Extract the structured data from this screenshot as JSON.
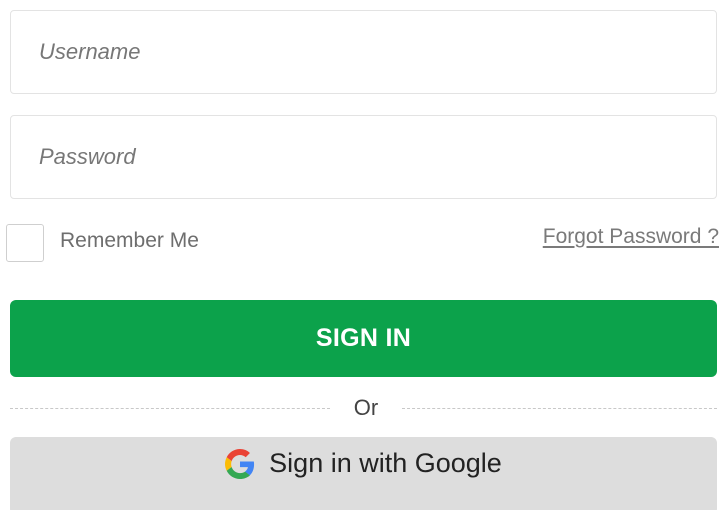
{
  "login": {
    "username_placeholder": "Username",
    "password_placeholder": "Password",
    "remember_label": "Remember Me",
    "forgot_label": "Forgot Password ?",
    "signin_label": "SIGN IN",
    "divider_text": "Or",
    "google_label": "Sign in with Google",
    "google_icon": "google-icon"
  },
  "colors": {
    "primary": "#0ca24b",
    "secondary_bg": "#dddddd",
    "border": "#e3e3e3"
  }
}
